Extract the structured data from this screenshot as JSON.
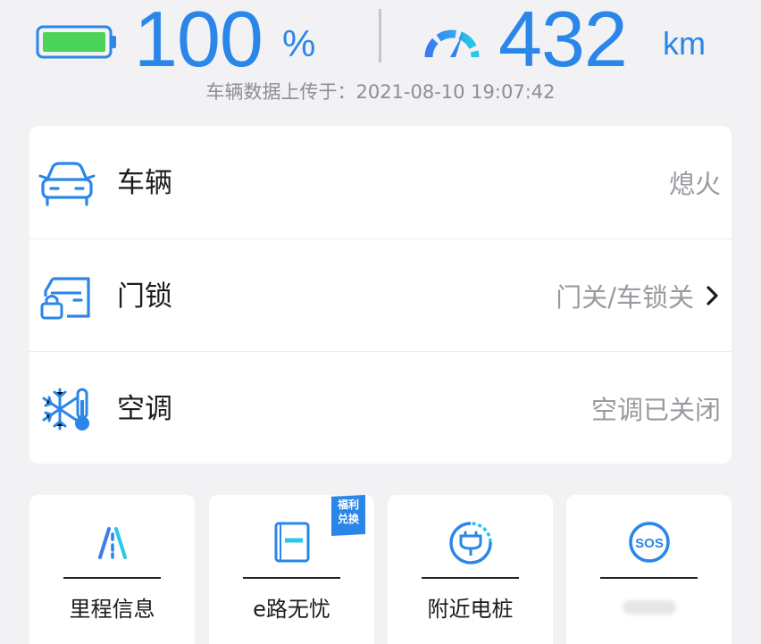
{
  "header": {
    "battery_percent": "100",
    "battery_unit": "%",
    "battery_level": 1.0,
    "range_value": "432",
    "range_unit": "km",
    "upload_time": "车辆数据上传于：2021-08-10 19:07:42"
  },
  "status": {
    "rows": [
      {
        "label": "车辆",
        "value": "熄火",
        "icon": "car-icon"
      },
      {
        "label": "门锁",
        "value": "门关/车锁关",
        "icon": "door-lock-icon"
      },
      {
        "label": "空调",
        "value": "空调已关闭",
        "icon": "snowflake-thermometer-icon"
      }
    ]
  },
  "tiles": [
    {
      "label": "里程信息",
      "icon": "road-icon"
    },
    {
      "label": "e路无忧",
      "icon": "booklet-icon",
      "badge": [
        "福利",
        "兑换"
      ]
    },
    {
      "label": "附近电桩",
      "icon": "charging-plug-icon"
    },
    {
      "label": "",
      "icon": "sos-icon"
    }
  ],
  "colors": {
    "accent": "#2a86e8",
    "battery_green": "#4cd35a",
    "background": "#f2f2f4"
  }
}
